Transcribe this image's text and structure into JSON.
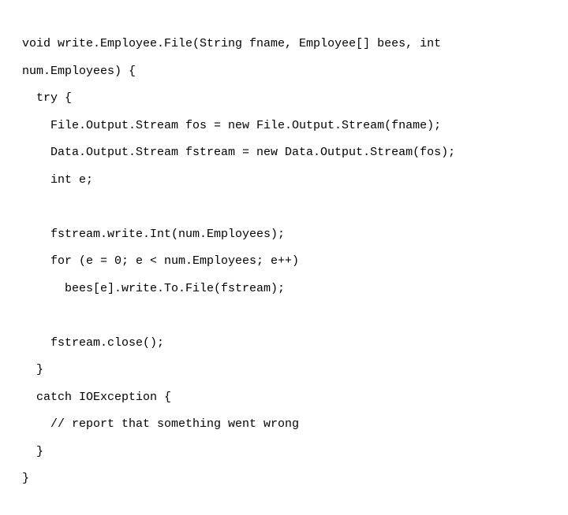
{
  "code": {
    "l01a": "void write.Employee.File(String fname, Employee[] bees, int",
    "l01b": "num.Employees) {",
    "l02": "try {",
    "l03": "File.Output.Stream fos = new File.Output.Stream(fname);",
    "l04": "Data.Output.Stream fstream = new Data.Output.Stream(fos);",
    "l05": "int e;",
    "l06": "",
    "l07": "fstream.write.Int(num.Employees);",
    "l08": "for (e = 0; e < num.Employees; e++)",
    "l09": "bees[e].write.To.File(fstream);",
    "l10": "",
    "l11": "fstream.close();",
    "l12": "}",
    "l13": "catch IOException {",
    "l14": "// report that something went wrong",
    "l15": "}",
    "l16": "}"
  }
}
